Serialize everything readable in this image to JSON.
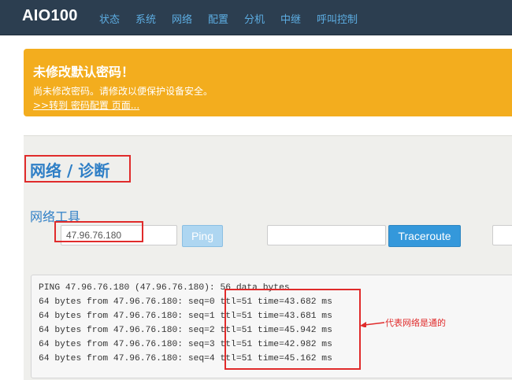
{
  "navbar": {
    "brand": "AIO100",
    "links": [
      "状态",
      "系统",
      "网络",
      "配置",
      "分机",
      "中继",
      "呼叫控制"
    ]
  },
  "alert": {
    "title": "未修改默认密码！",
    "text": "尚未修改密码。请修改以便保护设备安全。",
    "link": ">>转到 密码配置 页面..."
  },
  "page": {
    "title": "网络 / 诊断",
    "section_title": "网络工具"
  },
  "tools": {
    "ping_input_value": "47.96.76.180",
    "ping_button": "Ping",
    "traceroute_input_value": "",
    "traceroute_button": "Traceroute"
  },
  "output": {
    "lines": [
      "PING 47.96.76.180 (47.96.76.180): 56 data bytes",
      "64 bytes from 47.96.76.180: seq=0 ttl=51 time=43.682 ms",
      "64 bytes from 47.96.76.180: seq=1 ttl=51 time=43.681 ms",
      "64 bytes from 47.96.76.180: seq=2 ttl=51 time=45.942 ms",
      "64 bytes from 47.96.76.180: seq=3 ttl=51 time=42.982 ms",
      "64 bytes from 47.96.76.180: seq=4 ttl=51 time=45.162 ms"
    ]
  },
  "annotation": {
    "label": "代表网络是通的",
    "color": "#e02b2b"
  },
  "colors": {
    "navbar_bg": "#2c3e50",
    "nav_link": "#5dade2",
    "alert_bg": "#f3ad1e",
    "accent_blue": "#3498db",
    "title_blue": "#2f7fc6"
  }
}
